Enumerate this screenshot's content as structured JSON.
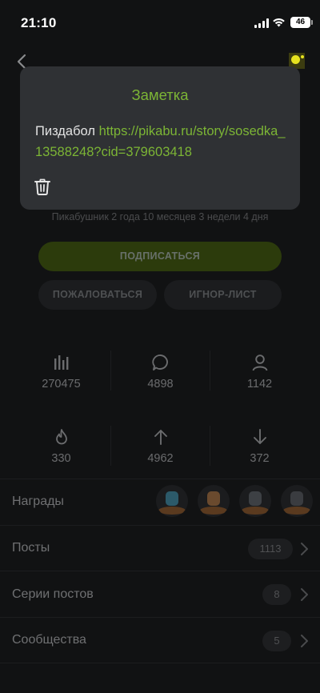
{
  "status_bar": {
    "time": "21:10",
    "battery": "46"
  },
  "note": {
    "title": "Заметка",
    "text": "Пиздабол ",
    "link": "https://pikabu.ru/story/sosedka_13588248?cid=379603418"
  },
  "profile": {
    "membership": "Пикабушник 2 года 10 месяцев 3 недели 4 дня"
  },
  "buttons": {
    "subscribe": "ПОДПИСАТЬСЯ",
    "report": "ПОЖАЛОВАТЬСЯ",
    "ignore": "ИГНОР-ЛИСТ"
  },
  "stats": {
    "rating": "270475",
    "comments": "4898",
    "subscribers": "1142",
    "hot": "330",
    "pluses": "4962",
    "minuses": "372"
  },
  "rows": {
    "awards": "Награды",
    "posts": "Посты",
    "posts_count": "1113",
    "series": "Серии постов",
    "series_count": "8",
    "communities": "Сообщества",
    "communities_count": "5"
  },
  "colors": {
    "accent": "#7cb535",
    "background": "#111213",
    "popup": "#2f3134"
  }
}
